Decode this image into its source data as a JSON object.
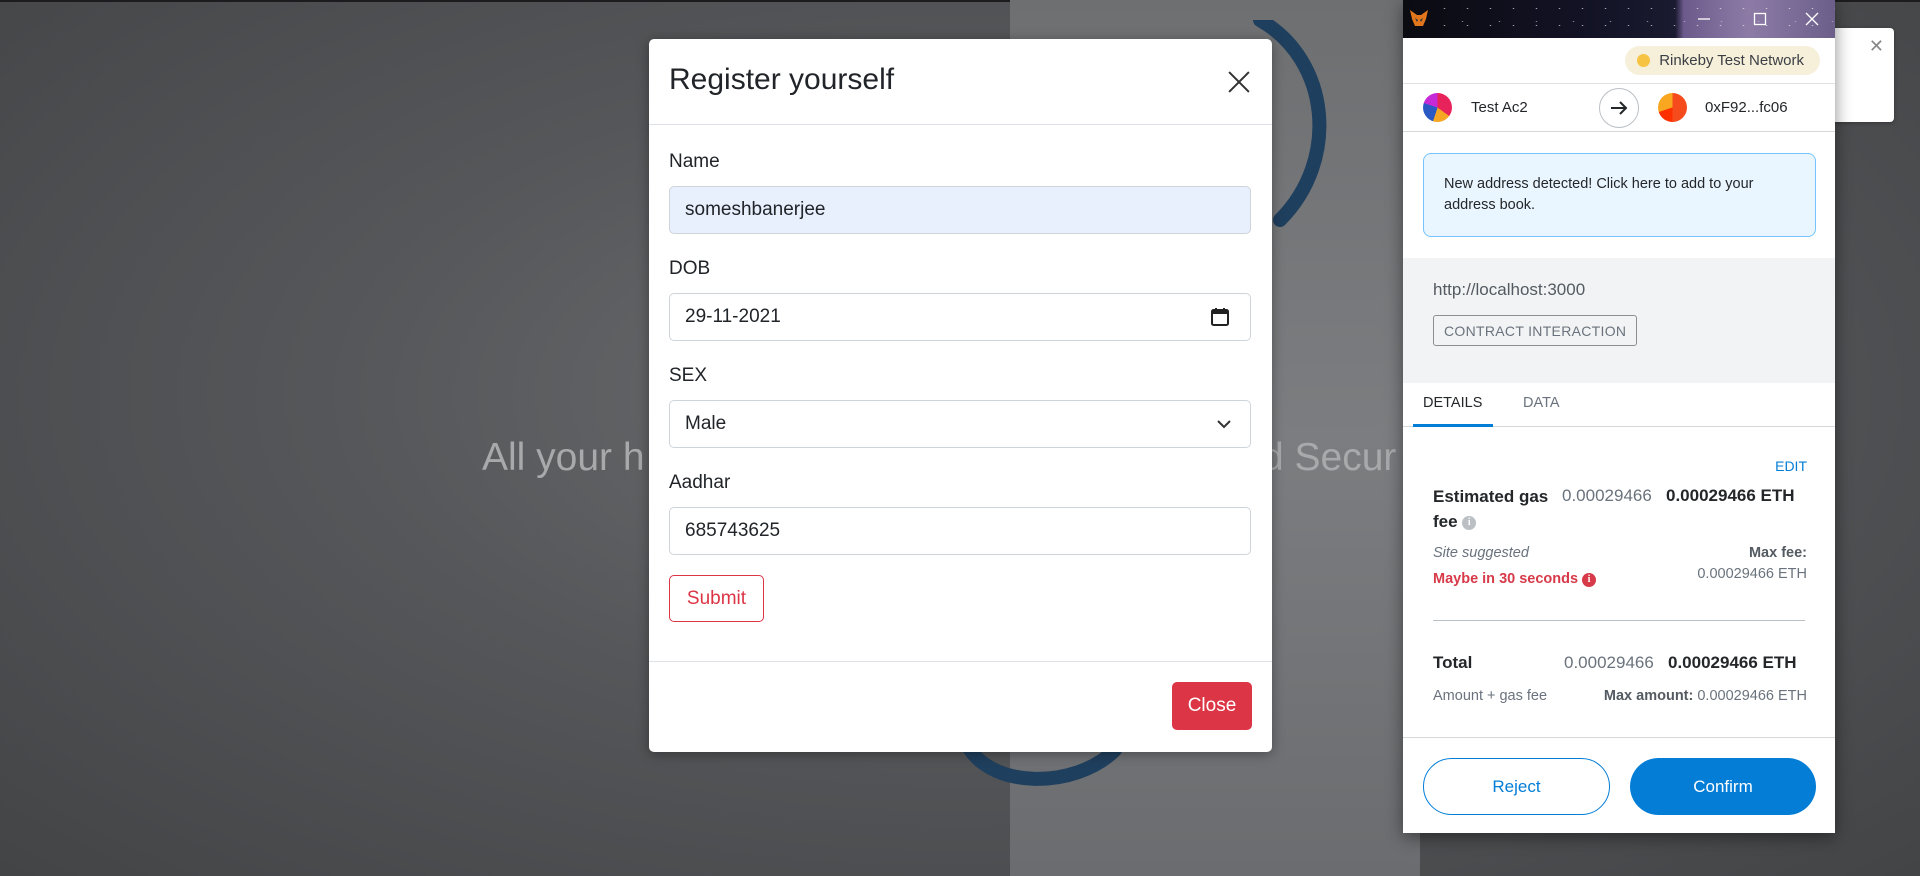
{
  "background": {
    "hero_left": "All your h",
    "hero_right": "d Secur"
  },
  "modal": {
    "title": "Register yourself",
    "fields": {
      "name_label": "Name",
      "name_value": "someshbanerjee",
      "dob_label": "DOB",
      "dob_value": "29-11-2021",
      "sex_label": "SEX",
      "sex_value": "Male",
      "aadhar_label": "Aadhar",
      "aadhar_value": "685743625"
    },
    "submit_label": "Submit",
    "close_label": "Close"
  },
  "metamask": {
    "network": "Rinkeby Test Network",
    "from_account": "Test Ac2",
    "to_account": "0xF92...fc06",
    "notice": "New address detected! Click here to add to your address book.",
    "origin": "http://localhost:3000",
    "interaction_badge": "CONTRACT INTERACTION",
    "tabs": [
      "DETAILS",
      "DATA"
    ],
    "edit_label": "EDIT",
    "gas_label": "Estimated gas fee",
    "gas_value_secondary": "0.00029466",
    "gas_value_primary": "0.00029466 ETH",
    "site_suggested": "Site suggested",
    "eta": "Maybe in 30 seconds",
    "max_fee_label": "Max fee:",
    "max_fee_value": "0.00029466 ETH",
    "total_label": "Total",
    "total_value_secondary": "0.00029466",
    "total_value_primary": "0.00029466 ETH",
    "amount_gas_label": "Amount + gas fee",
    "max_amount_label": "Max amount:",
    "max_amount_value": "0.00029466 ETH",
    "reject_label": "Reject",
    "confirm_label": "Confirm"
  },
  "colors": {
    "danger": "#dc3545",
    "metamask_blue": "#037dd6",
    "warning_red": "#d73a49",
    "network_dot": "#f6c343"
  }
}
